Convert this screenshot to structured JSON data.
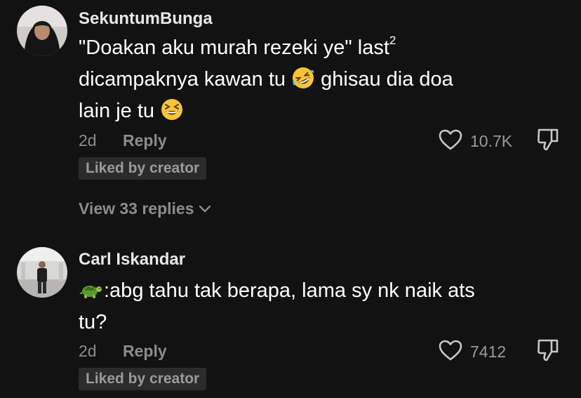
{
  "comments": [
    {
      "username": "SekuntumBunga",
      "avatar": "hijab-woman-avatar",
      "lines": [
        "\"Doakan aku murah rezeki ye\" last",
        "dicampaknya kawan tu",
        "ghisau dia doa",
        "lain je tu"
      ],
      "superscript": "2",
      "emojis": [
        "rolling-on-floor-laughing-emoji",
        "grinning-squinting-face-emoji"
      ],
      "date": "2d",
      "reply_label": "Reply",
      "likes": "10.7K",
      "badge": "Liked by creator",
      "view_replies": "View 33 replies"
    },
    {
      "username": "Carl Iskandar",
      "avatar": "man-standing-photo-avatar",
      "lines": [
        ":abg tahu tak berapa, lama sy nk naik ats",
        "tu?"
      ],
      "emojis": [
        "turtle-emoji"
      ],
      "date": "2d",
      "reply_label": "Reply",
      "likes": "7412",
      "badge": "Liked by creator"
    }
  ],
  "icons": {
    "like": "heart-outline-icon",
    "dislike": "thumbs-down-outline-icon",
    "expand": "chevron-down-icon"
  },
  "colors": {
    "background": "#121212",
    "text": "#ffffff",
    "meta": "#8c8c8c",
    "badge_bg": "#2b2b2b"
  }
}
